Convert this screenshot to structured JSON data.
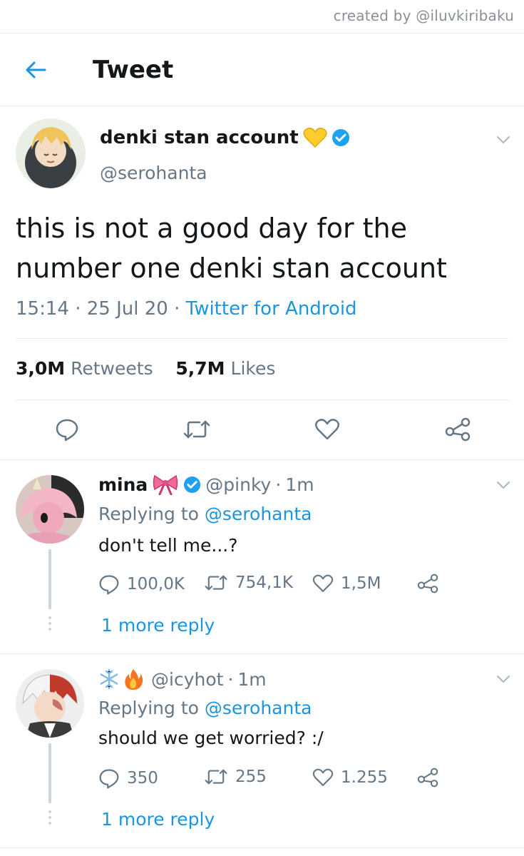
{
  "credit": "created by @iluvkiribaku",
  "header": {
    "title": "Tweet"
  },
  "main_tweet": {
    "name": "denki stan account",
    "handle": "@serohanta",
    "text": "this is not a good day for the number one denki stan account",
    "time": "15:14",
    "date": "25 Jul 20",
    "source": "Twitter for Android",
    "retweets_count": "3,0M",
    "retweets_label": "Retweets",
    "likes_count": "5,7M",
    "likes_label": "Likes"
  },
  "replies": [
    {
      "name": "mina",
      "handle": "@pinky",
      "time": "1m",
      "replying_prefix": "Replying to",
      "replying_to": "@serohanta",
      "text": "don't tell me...?",
      "comments": "100,0K",
      "retweets": "754,1K",
      "likes": "1,5M",
      "more": "1 more reply"
    },
    {
      "name": "",
      "handle": "@icyhot",
      "time": "1m",
      "replying_prefix": "Replying to",
      "replying_to": "@serohanta",
      "text": "should we get worried? :/",
      "comments": "350",
      "retweets": "255",
      "likes": "1.255",
      "more": "1 more reply"
    }
  ],
  "colors": {
    "accent": "#1b95e0",
    "muted": "#657786",
    "text": "#14171a",
    "divider": "#e6ecf0"
  }
}
